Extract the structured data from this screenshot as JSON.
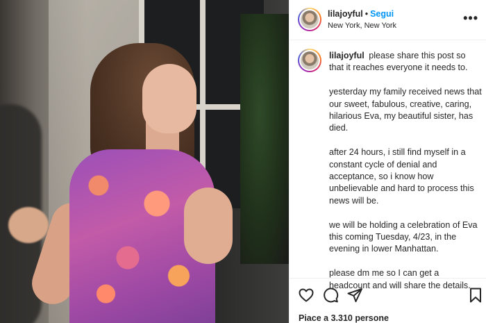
{
  "post": {
    "username": "lilajoyful",
    "separator": "•",
    "follow_label": "Segui",
    "location": "New York, New York",
    "more_label": "•••"
  },
  "caption": {
    "username": "lilajoyful",
    "intro": "please share this post so that it reaches everyone it needs to.",
    "paragraphs": [
      "yesterday my family received news that our sweet, fabulous, creative, caring, hilarious Eva, my beautiful sister, has died.",
      "after 24 hours, i still find myself in a constant cycle of denial and acceptance, so i know how unbelievable and hard to process this news will be.",
      "we will be holding a celebration of Eva this coming Tuesday, 4/23, in the evening in lower Manhattan.",
      "please dm me so I can get a headcount and will share the details."
    ]
  },
  "actions": {
    "icons": [
      "heart-icon",
      "comment-icon",
      "share-icon",
      "bookmark-icon"
    ],
    "likes_text": "Piace a 3.310 persone"
  },
  "colors": {
    "accent": "#0095f6",
    "text": "#262626",
    "divider": "#efefef"
  }
}
